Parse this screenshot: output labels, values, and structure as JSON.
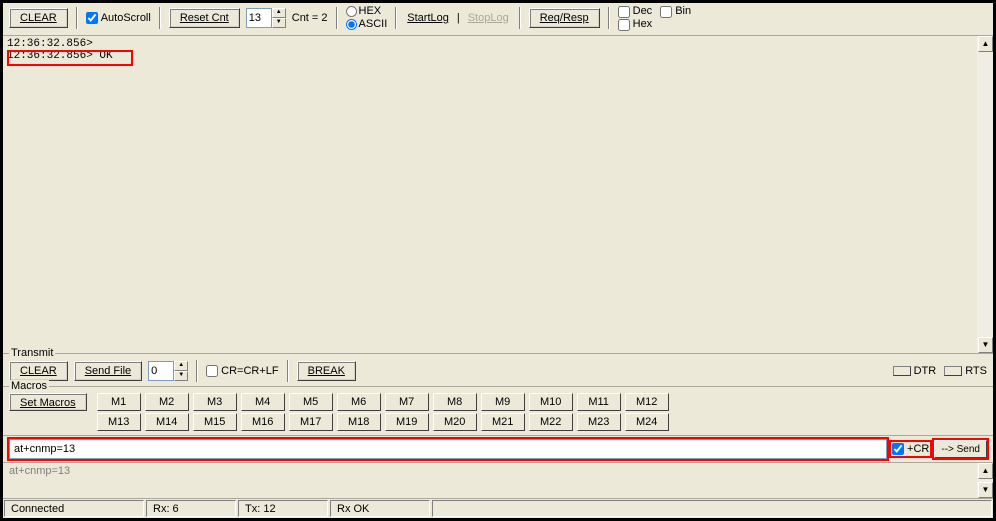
{
  "toolbar": {
    "clear": "CLEAR",
    "autoscroll": "AutoScroll",
    "resetcnt": "Reset Cnt",
    "cnt_spin": "13",
    "cnt_label": "Cnt = 2",
    "radio_hex": "HEX",
    "radio_ascii": "ASCII",
    "startlog": "StartLog",
    "stoplog": "StopLog",
    "reqresp": "Req/Resp",
    "chk_dec": "Dec",
    "chk_bin": "Bin",
    "chk_hex": "Hex"
  },
  "receive": {
    "line1": "12:36:32.856>",
    "line2": "12:36:32.856> OK"
  },
  "transmit": {
    "legend": "Transmit",
    "clear": "CLEAR",
    "sendfile": "Send File",
    "spin": "0",
    "crlf": "CR=CR+LF",
    "break": "BREAK",
    "dtr": "DTR",
    "rts": "RTS"
  },
  "macros": {
    "legend": "Macros",
    "setmacros": "Set Macros",
    "row1": [
      "M1",
      "M2",
      "M3",
      "M4",
      "M5",
      "M6",
      "M7",
      "M8",
      "M9",
      "M10",
      "M11",
      "M12"
    ],
    "row2": [
      "M13",
      "M14",
      "M15",
      "M16",
      "M17",
      "M18",
      "M19",
      "M20",
      "M21",
      "M22",
      "M23",
      "M24"
    ]
  },
  "command": {
    "value": "at+cnmp=13",
    "cr": "+CR",
    "send": "--> Send"
  },
  "log": {
    "line1": "at+cnmp=13"
  },
  "status": {
    "connected": "Connected",
    "rx": "Rx: 6",
    "tx": "Tx: 12",
    "rxok": "Rx OK"
  }
}
